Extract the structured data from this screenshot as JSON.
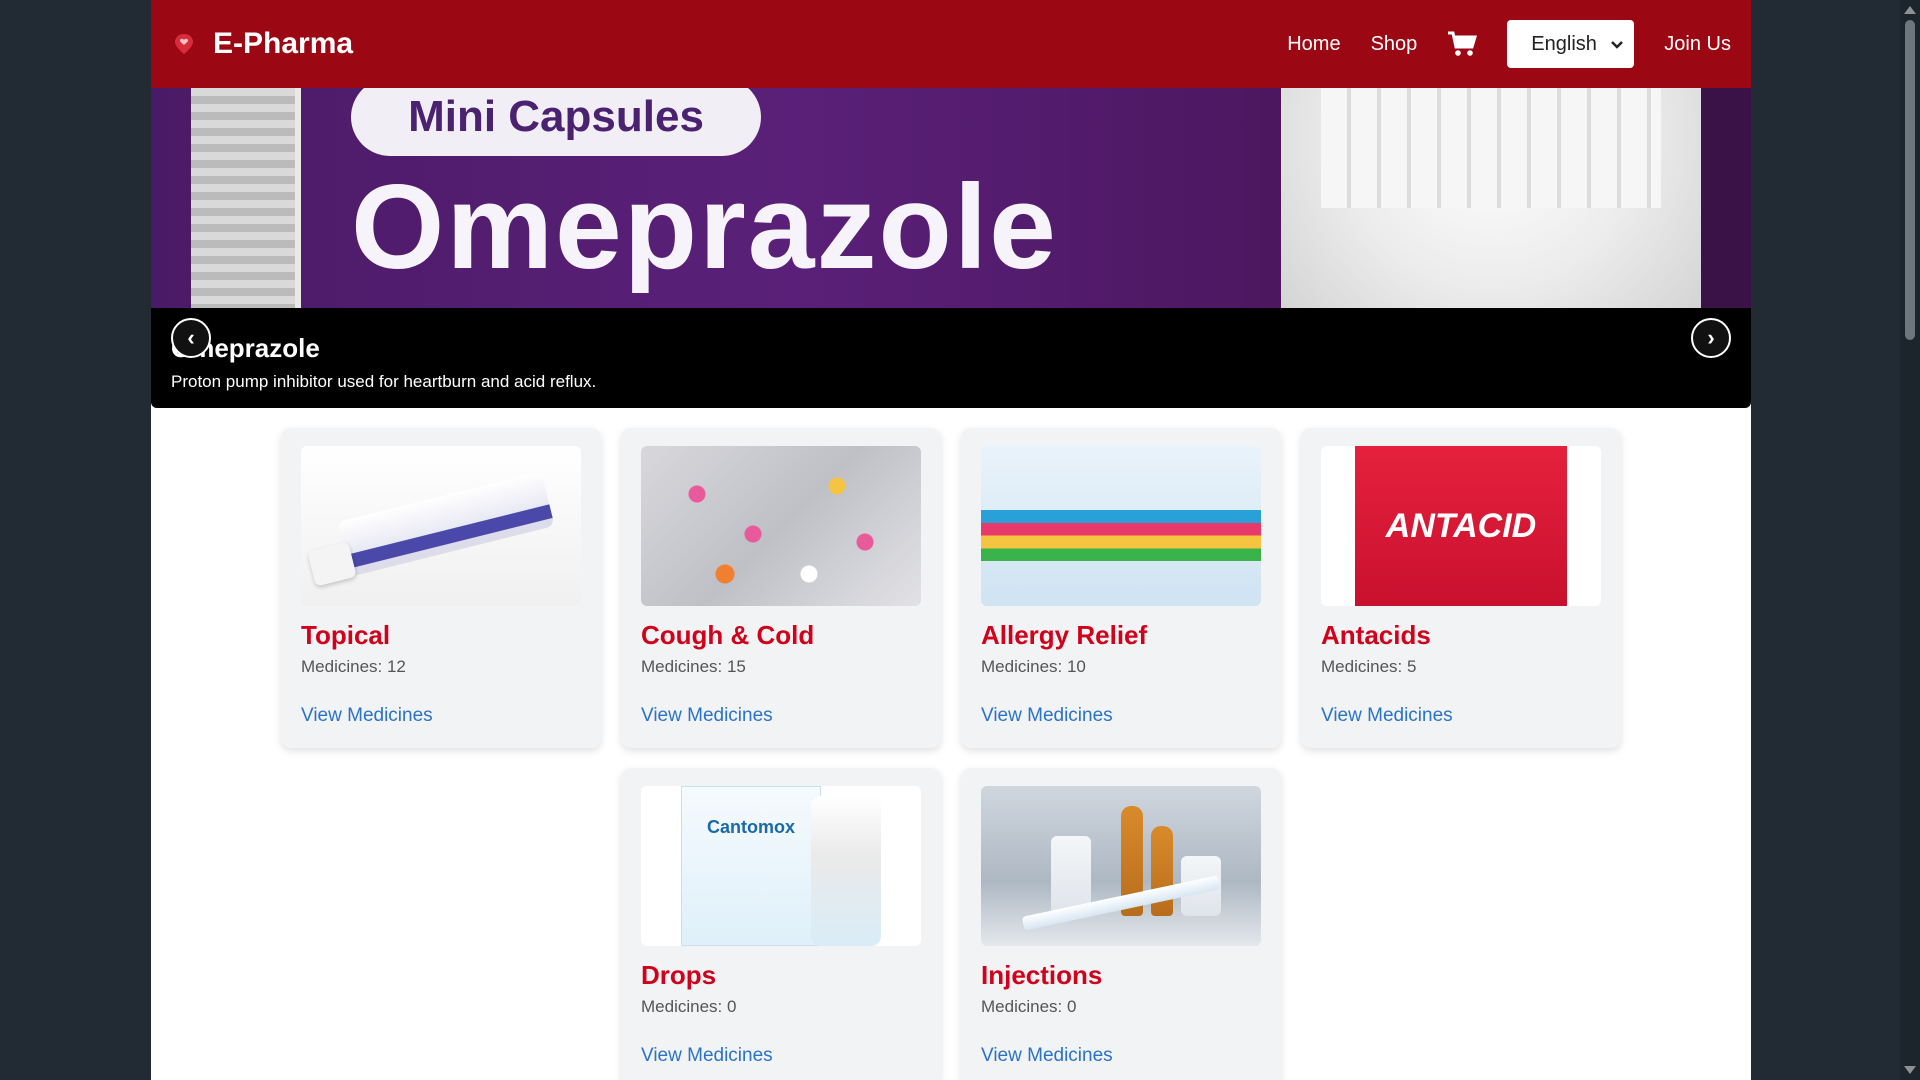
{
  "colors": {
    "navbar": "#9c0714",
    "backdrop": "#222b33",
    "card_title": "#d0021b",
    "link": "#2a73c7",
    "caption_bg": "#000000"
  },
  "navbar": {
    "brand": "E-Pharma",
    "logo_icon": "heart-pin-icon",
    "links": {
      "home": "Home",
      "shop": "Shop",
      "join": "Join Us"
    },
    "cart_icon": "shopping-cart-icon",
    "language": {
      "selected": "English",
      "icon": "chevron-down-icon"
    }
  },
  "carousel": {
    "image_text_top": "Mini Capsules",
    "image_text_main": "Omeprazole",
    "title": "Omeprazole",
    "description": "Proton pump inhibitor used for heartburn and acid reflux.",
    "prev": "‹",
    "next": "›"
  },
  "categories": [
    {
      "name": "Topical",
      "count": "Medicines: 12",
      "link": "View Medicines"
    },
    {
      "name": "Cough & Cold",
      "count": "Medicines: 15",
      "link": "View Medicines"
    },
    {
      "name": "Allergy Relief",
      "count": "Medicines: 10",
      "link": "View Medicines"
    },
    {
      "name": "Antacids",
      "count": "Medicines: 5",
      "link": "View Medicines"
    },
    {
      "name": "Drops",
      "count": "Medicines: 0",
      "link": "View Medicines"
    },
    {
      "name": "Injections",
      "count": "Medicines: 0",
      "link": "View Medicines"
    }
  ],
  "image_labels": {
    "antacid_box": "ANTACID",
    "drops_box": "Cantomox"
  }
}
